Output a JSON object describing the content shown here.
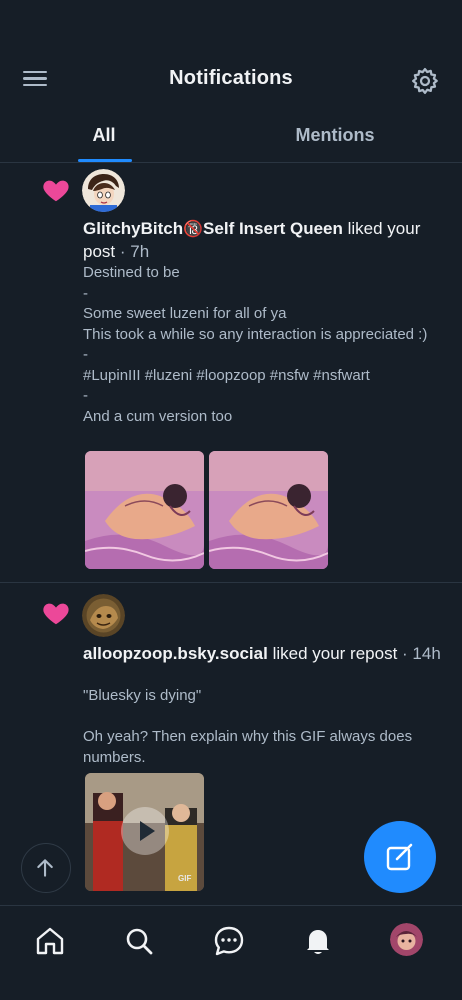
{
  "header": {
    "title": "Notifications",
    "menu_icon": "menu-icon",
    "settings_icon": "gear-icon"
  },
  "tabs": [
    {
      "label": "All",
      "active": true
    },
    {
      "label": "Mentions",
      "active": false
    }
  ],
  "notifications": [
    {
      "kind": "like",
      "user": "GlitchyBitch",
      "badge": "🔞",
      "user_suffix": "Self Insert Queen",
      "action": " liked your post",
      "time": " · 7h",
      "body": "Destined to be\n-\nSome sweet luzeni for all of ya\nThis took a while so any interaction is appreciated :)\n-\n#LupinIII #luzeni #loopzoop #nsfw #nsfwart\n-\nAnd a cum version too",
      "media_count": 2
    },
    {
      "kind": "like",
      "user": "alloopzoop.bsky.social",
      "action": " liked your repost",
      "time": " · 14h",
      "body": "\"Bluesky is dying\"\n\nOh yeah? Then explain why this GIF always does numbers.",
      "media_label": "GIF"
    }
  ],
  "colors": {
    "background": "#161e27",
    "accent": "#208bfe",
    "heart": "#ec4899",
    "muted_text": "#aebbc9"
  },
  "bottom_nav": [
    "home-icon",
    "search-icon",
    "chat-icon",
    "bell-icon",
    "profile-avatar"
  ]
}
